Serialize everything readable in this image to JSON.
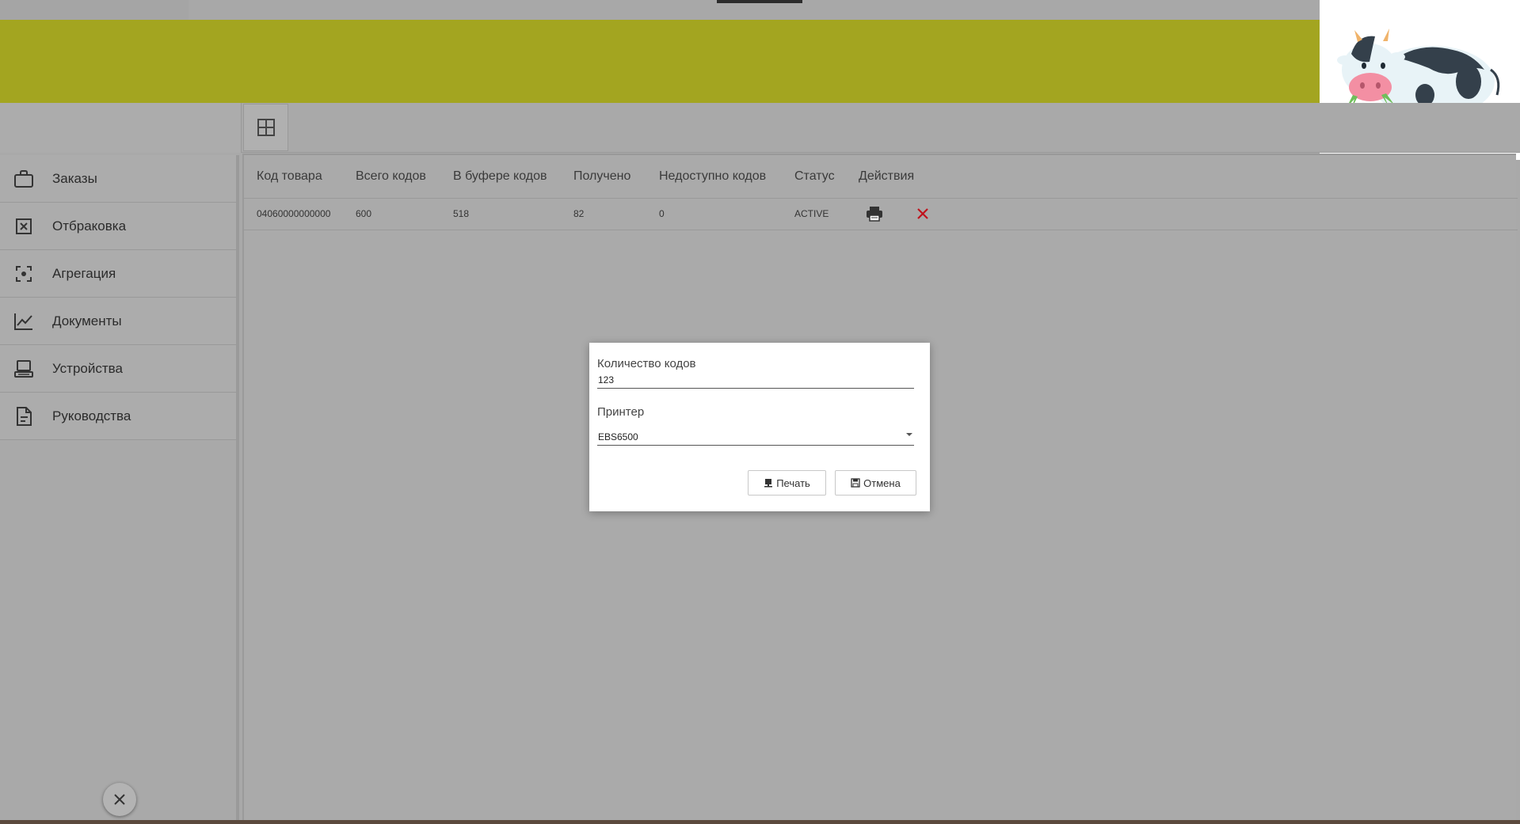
{
  "sidebar": {
    "items": [
      {
        "label": "Заказы",
        "icon": "briefcase-icon"
      },
      {
        "label": "Отбраковка",
        "icon": "reject-box-icon"
      },
      {
        "label": "Агрегация",
        "icon": "focus-center-icon"
      },
      {
        "label": "Документы",
        "icon": "line-chart-icon"
      },
      {
        "label": "Устройства",
        "icon": "device-icon"
      },
      {
        "label": "Руководства",
        "icon": "document-icon"
      }
    ]
  },
  "table": {
    "headers": [
      "Код товара",
      "Всего кодов",
      "В буфере кодов",
      "Получено",
      "Недоступно кодов",
      "Статус",
      "Действия"
    ],
    "rows": [
      {
        "product_code": "04060000000000",
        "total": "600",
        "buffer": "518",
        "received": "82",
        "unavailable": "0",
        "status": "ACTIVE"
      }
    ]
  },
  "dialog": {
    "quantity_label": "Количество кодов",
    "quantity_value": "123",
    "printer_label": "Принтер",
    "printer_value": "EBS6500",
    "print_button": "Печать",
    "cancel_button": "Отмена"
  },
  "colors": {
    "header_band": "#a3a520",
    "overlay_background": "#a9a9a9",
    "delete_red": "#c0121c"
  }
}
